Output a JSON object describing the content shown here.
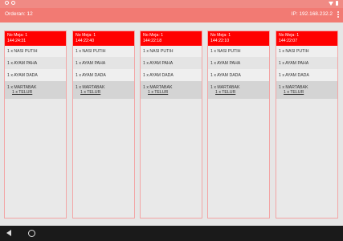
{
  "appbar": {
    "title": "Orderan: 12",
    "ip": "IP: 192.168.232.2"
  },
  "cards": [
    {
      "meja": "No Meja: 1",
      "time": "144:24:31",
      "items": [
        "1 x NASI PUTIH",
        "1 x AYAM PAHA",
        "1 x AYAM DADA",
        "1 x MARTABAK"
      ],
      "sub": "1 x TELUR"
    },
    {
      "meja": "No Meja: 1",
      "time": "144:22:40",
      "items": [
        "1 x NASI PUTIH",
        "1 x AYAM PAHA",
        "1 x AYAM DADA",
        "1 x MARTABAK"
      ],
      "sub": "1 x TELUR"
    },
    {
      "meja": "No Meja: 1",
      "time": "144:22:18",
      "items": [
        "1 x NASI PUTIH",
        "1 x AYAM PAHA",
        "1 x AYAM DADA",
        "1 x MARTABAK"
      ],
      "sub": "1 x TELUR"
    },
    {
      "meja": "No Meja: 1",
      "time": "144:22:10",
      "items": [
        "1 x NASI PUTIH",
        "1 x AYAM PAHA",
        "1 x AYAM DADA",
        "1 x MARTABAK"
      ],
      "sub": "1 x TELUR"
    },
    {
      "meja": "No Meja: 1",
      "time": "144:22:07",
      "items": [
        "1 x NASI PUTIH",
        "1 x AYAM PAHA",
        "1 x AYAM DADA",
        "1 x MARTABAK"
      ],
      "sub": "1 x TELUR"
    }
  ],
  "colors": {
    "appbar": "#f27a73",
    "card_header": "#ff0000"
  }
}
